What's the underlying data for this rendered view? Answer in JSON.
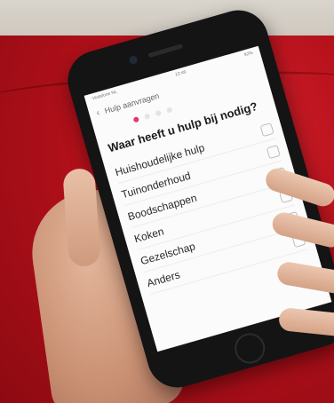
{
  "screen": {
    "status_left": "Vodafone NL",
    "status_time": "12:46",
    "status_right": "92%",
    "nav_title": "Hulp aanvragen",
    "progress_steps": 4,
    "progress_active_index": 0,
    "question": "Waar heeft u hulp bij nodig?",
    "options": [
      {
        "label": "Huishoudelijke hulp",
        "checked": false
      },
      {
        "label": "Tuinonderhoud",
        "checked": false
      },
      {
        "label": "Boodschappen",
        "checked": false
      },
      {
        "label": "Koken",
        "checked": false
      },
      {
        "label": "Gezelschap",
        "checked": false
      },
      {
        "label": "Anders",
        "checked": false
      }
    ]
  },
  "colors": {
    "accent": "#e8327a",
    "couch": "#b3101a",
    "phone_body": "#141414"
  },
  "icons": {
    "back": "chevron-left-icon",
    "checkbox": "checkbox-icon"
  }
}
